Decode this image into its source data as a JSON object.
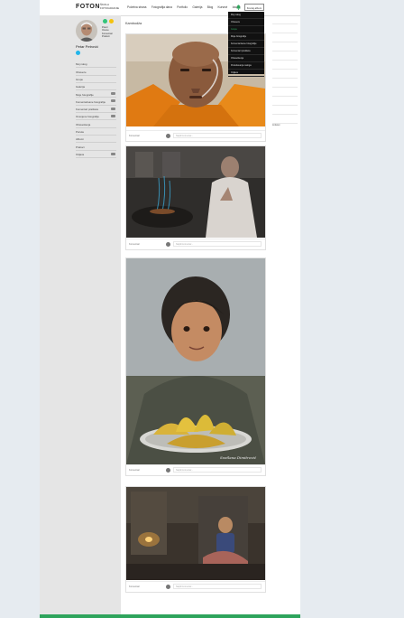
{
  "header": {
    "logo": "FOTON",
    "logo_sub": "ŠKOLA FOTOGRAFIJE",
    "nav": [
      "Početna strana",
      "Fotografija dana",
      "Portfolio",
      "Galerija",
      "Blog",
      "Kursevi",
      "Izazov"
    ],
    "create_button": "Kreiraj album"
  },
  "profile": {
    "name": "Petar Petrović",
    "stats": [
      "Poeni",
      "Ocene",
      "Komentari",
      "Pratioci"
    ]
  },
  "sidebar": {
    "items": [
      {
        "label": "Moj nalog",
        "badge": false
      },
      {
        "label": "Obaveze",
        "badge": false
      },
      {
        "label": "Grupe",
        "badge": false
      },
      {
        "label": "Galerija",
        "badge": false
      },
      {
        "label": "Moje fotografije",
        "badge": true
      },
      {
        "label": "Komentarisane fotografije",
        "badge": true
      },
      {
        "label": "Komentari pratilaca",
        "badge": true
      },
      {
        "label": "Ocenjene fotografije",
        "badge": true
      },
      {
        "label": "Obaveštenja",
        "badge": false
      },
      {
        "label": "Poruke",
        "badge": false
      },
      {
        "label": "Albumi",
        "badge": false
      },
      {
        "label": "Pratioci",
        "badge": false
      },
      {
        "label": "Odjava",
        "badge": true
      }
    ]
  },
  "content": {
    "title": "Kambodža",
    "cards": [
      {
        "comments": "Komentari",
        "placeholder": "Napiši komentar..."
      },
      {
        "comments": "Komentari",
        "placeholder": "Napiši komentar..."
      },
      {
        "comments": "Komentari",
        "placeholder": "Napiši komentar..."
      },
      {
        "comments": "Komentari",
        "placeholder": "Napiši komentar..."
      }
    ],
    "watermark": "Svetlana Dimitrović"
  },
  "dropdown": {
    "items": [
      "Moj nalog",
      "Obaveze",
      "Grupe",
      "Moje fotografije",
      "Komentarisane fotografije",
      "Komentari pratilaca",
      "Obaveštenja",
      "Podešavanja naloga",
      "Odjava"
    ]
  },
  "right": {
    "label": "Linkovi"
  },
  "colors": {
    "accent_green": "#2ea45c",
    "dot_green": "#33c479",
    "dot_yellow": "#f4c20d",
    "dot_blue": "#22b5ea"
  }
}
